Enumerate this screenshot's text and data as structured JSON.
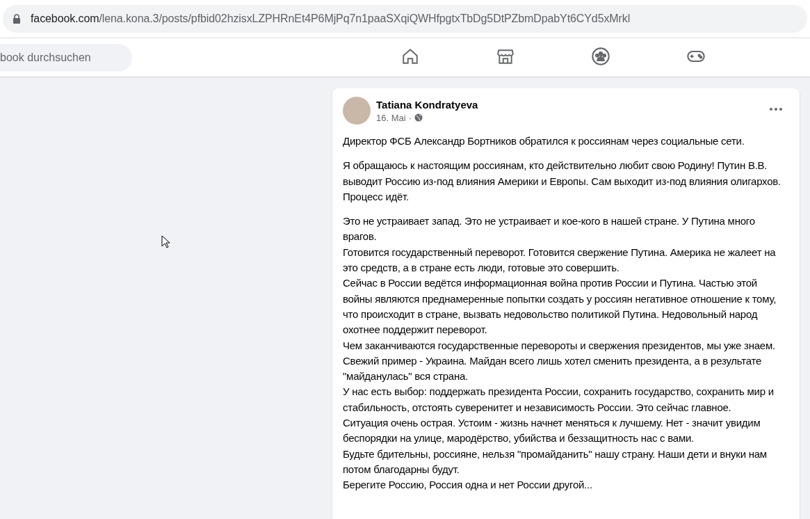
{
  "browser": {
    "url_host": "facebook.com",
    "url_path": "/lena.kona.3/posts/pfbid02hzisxLZPHRnEt4P6MjPq7n1paaSXqiQWHfpgtxTbDg5DtPZbmDpabYt6CYd5xMrkl"
  },
  "header": {
    "search": {
      "placeholder": "book durchsuchen"
    },
    "nav": [
      {
        "kind": "home",
        "selected": false
      },
      {
        "kind": "marketplace",
        "selected": false
      },
      {
        "kind": "groups",
        "selected": false
      },
      {
        "kind": "gaming",
        "selected": false
      }
    ]
  },
  "post": {
    "author": "Tatiana Kondratyeva",
    "date": "16. Mai",
    "separator": "·",
    "paragraphs": [
      [
        "Директор ФСБ Александр Бортников обратился к россиянам через социальные сети."
      ],
      [
        "Я обращаюсь к настоящим россиянам, кто действительно любит свою Родину! Путин В.В. выводит Россию  из-под влияния Америки и Европы. Сам выходит из-под влияния олигархов. Процесс идёт."
      ],
      [
        "Это не устраивает запад. Это не устраивает и кое-кого в нашей стране. У Путина много врагов.",
        "Готовится государственный переворот. Готовится свержение Путина. Америка не жалеет на это средств, а в стране есть люди, готовые это совершить.",
        "Сейчас в России ведётся информационная война против России и Путина. Частью этой войны являются преднамеренные попытки создать у россиян негативное отношение к тому, что происходит в стране, вызвать недовольство политикой Путина. Недовольный народ охотнее поддержит переворот.",
        "Чем заканчиваются государственные перевороты и свержения президентов, мы уже знаем. Свежий пример - Украина. Майдан всего лишь хотел сменить президента, а в результате \"майданулась\" вся страна.",
        "У нас есть выбор: поддержать президента России, сохранить государство, сохранить мир и стабильность, отстоять суверенитет и независимость России. Это сейчас главное.",
        "Ситуация очень острая. Устоим - жизнь начнет меняться к лучшему. Нет - значит увидим беспорядки на улице, мародёрство, убийства и беззащитность нас с вами.",
        "Будьте бдительны, россияне, нельзя \"промайданить\" нашу страну. Наши дети и внуки нам потом благодарны будут.",
        "Берегите Россию, Россия одна  и нет России другой..."
      ]
    ]
  }
}
